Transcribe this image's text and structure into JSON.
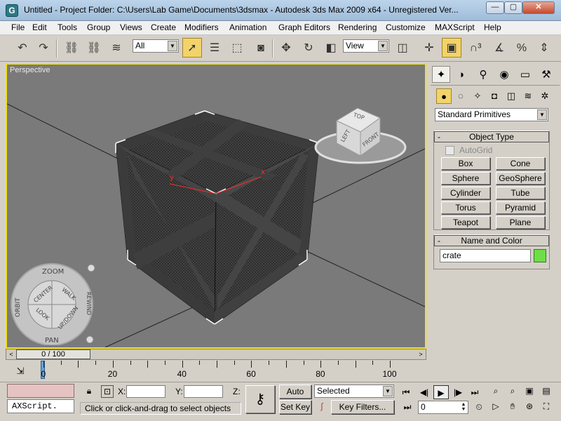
{
  "titlebar": {
    "title": "Untitled      - Project Folder: C:\\Users\\Lab Game\\Documents\\3dsmax      - Autodesk 3ds Max  2009 x64    - Unregistered Ver...",
    "minimize": "—",
    "maximize": "▢",
    "close": "✕"
  },
  "menu": [
    "File",
    "Edit",
    "Tools",
    "Group",
    "Views",
    "Create",
    "Modifiers",
    "Animation",
    "Graph Editors",
    "Rendering",
    "Customize",
    "MAXScript",
    "Help"
  ],
  "toolbar": {
    "selection_filter": "All",
    "reference_coord": "View"
  },
  "viewport": {
    "label": "Perspective",
    "viewcube": {
      "top": "TOP",
      "left": "LEFT",
      "front": "FRONT"
    },
    "navwheel": {
      "zoom": "ZOOM",
      "orbit": "ORBIT",
      "center": "CENTER",
      "walk": "WALK",
      "rewind": "REWIND",
      "look": "LOOK",
      "updown": "UP/DOWN",
      "pan": "PAN"
    },
    "gizmo": {
      "x": "x",
      "y": "y"
    }
  },
  "command_panel": {
    "category": "Standard Primitives",
    "object_type_title": "Object Type",
    "autogrid": "AutoGrid",
    "primitives": [
      "Box",
      "Cone",
      "Sphere",
      "GeoSphere",
      "Cylinder",
      "Tube",
      "Torus",
      "Pyramid",
      "Teapot",
      "Plane"
    ],
    "name_color_title": "Name and Color",
    "object_name": "crate",
    "object_color": "#6ede47"
  },
  "timeslider": {
    "label": "0 / 100",
    "left": "<",
    "right": ">"
  },
  "trackbar": {
    "labels": [
      "0",
      "20",
      "40",
      "60",
      "80",
      "100"
    ]
  },
  "status": {
    "listener": "AXScript.",
    "x_label": "X:",
    "y_label": "Y:",
    "z_label": "Z:",
    "prompt": "Click or click-and-drag to select objects",
    "auto_key": "Auto Key",
    "set_key": "Set Key",
    "key_mode": "Selected",
    "key_filters": "Key Filters...",
    "current_frame": "0"
  }
}
